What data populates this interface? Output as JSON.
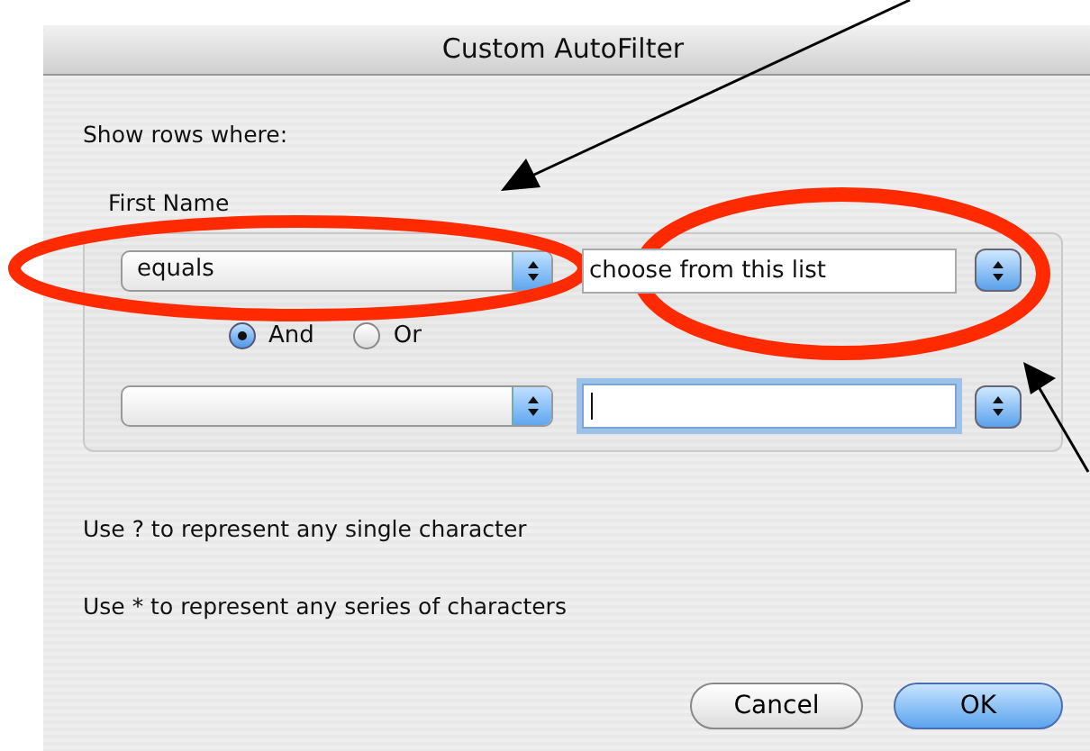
{
  "window": {
    "title": "Custom AutoFilter"
  },
  "prompt": "Show rows where:",
  "group": {
    "label": "First Name",
    "conditions": [
      {
        "operator": "equals",
        "value": "choose from this list",
        "focused": false
      },
      {
        "focused": true
      }
    ],
    "logic": [
      {
        "label": "And",
        "selected": true
      },
      {
        "label": "Or",
        "selected": false
      }
    ]
  },
  "hints": [
    "Use ? to represent any single character",
    "Use * to represent any series of characters"
  ],
  "buttons": [
    {
      "label": "Cancel",
      "default": false
    },
    {
      "label": "OK",
      "default": true
    }
  ]
}
